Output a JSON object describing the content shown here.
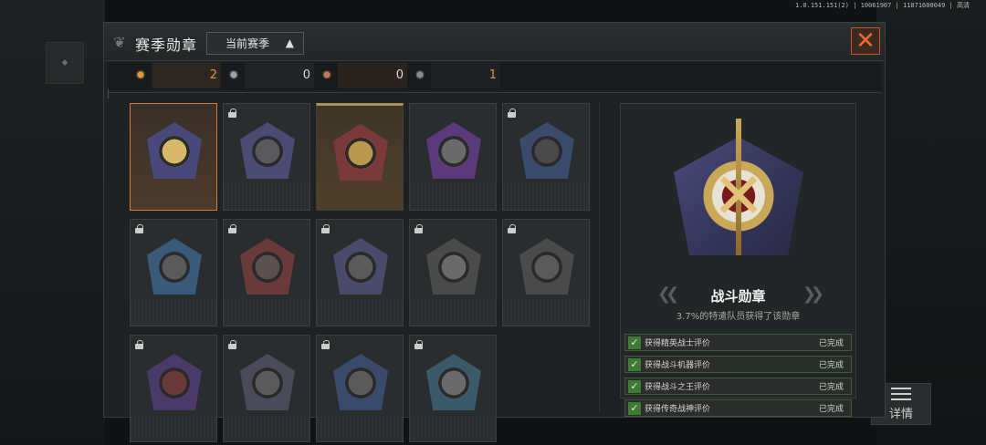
{
  "status_bar": {
    "text": "1.0.151.151(2) | 10061907 | 11871600049 | 高清"
  },
  "side": {
    "left_button_label": ""
  },
  "header": {
    "title": "赛季勋章",
    "season_select_value": "当前赛季"
  },
  "counters": [
    {
      "icon": "gold-medal-icon",
      "value": "2",
      "color": "#d69a3a"
    },
    {
      "icon": "silver-medal-icon",
      "value": "0",
      "color": "#9aa0a4"
    },
    {
      "icon": "bronze-medal-icon",
      "value": "0",
      "color": "#c27a52"
    },
    {
      "icon": "grey-medal-icon",
      "value": "1",
      "color": "#8a8d8e"
    }
  ],
  "medals": [
    {
      "id": "medal-combat",
      "locked": false,
      "state": "selected",
      "shield": "#48487a",
      "core": "#d8b86a"
    },
    {
      "id": "medal-2",
      "locked": true,
      "state": "normal",
      "shield": "#4a4a72",
      "core": "#5a5a5e"
    },
    {
      "id": "medal-3",
      "locked": false,
      "state": "gold",
      "shield": "#7a3a3a",
      "core": "#b8984a"
    },
    {
      "id": "medal-4",
      "locked": false,
      "state": "normal",
      "shield": "#5a3a7a",
      "core": "#6a6a6a"
    },
    {
      "id": "medal-5",
      "locked": true,
      "state": "normal",
      "shield": "#3a4a6a",
      "core": "#4a4a4a"
    },
    {
      "id": "medal-6",
      "locked": true,
      "state": "normal",
      "shield": "#3a5a7a",
      "core": "#5a5a5a"
    },
    {
      "id": "medal-7",
      "locked": true,
      "state": "normal",
      "shield": "#6a3a3a",
      "core": "#5a5050"
    },
    {
      "id": "medal-8",
      "locked": true,
      "state": "normal",
      "shield": "#4a4a6a",
      "core": "#5a5a5a"
    },
    {
      "id": "medal-9",
      "locked": true,
      "state": "normal",
      "shield": "#4a4a4a",
      "core": "#6a6a6a"
    },
    {
      "id": "medal-10",
      "locked": true,
      "state": "normal",
      "shield": "#4a4a4a",
      "core": "#5a5a5a"
    },
    {
      "id": "medal-11",
      "locked": true,
      "state": "normal",
      "shield": "#4a3a6a",
      "core": "#6a3a3a"
    },
    {
      "id": "medal-12",
      "locked": true,
      "state": "normal",
      "shield": "#4a4a5a",
      "core": "#5a5a5a"
    },
    {
      "id": "medal-13",
      "locked": true,
      "state": "normal",
      "shield": "#3a4a6a",
      "core": "#5a5a5a"
    },
    {
      "id": "medal-14",
      "locked": true,
      "state": "normal",
      "shield": "#3a5a6a",
      "core": "#6a6a6a"
    }
  ],
  "detail": {
    "name": "战斗勋章",
    "description": "3.7%的特遣队员获得了该勋章",
    "conditions": [
      {
        "label": "获得精英战士评价",
        "status": "已完成"
      },
      {
        "label": "获得战斗机器评价",
        "status": "已完成"
      },
      {
        "label": "获得战斗之王评价",
        "status": "已完成"
      },
      {
        "label": "获得传奇战神评价",
        "status": "已完成"
      }
    ]
  },
  "detail_button": {
    "label": "详情"
  }
}
